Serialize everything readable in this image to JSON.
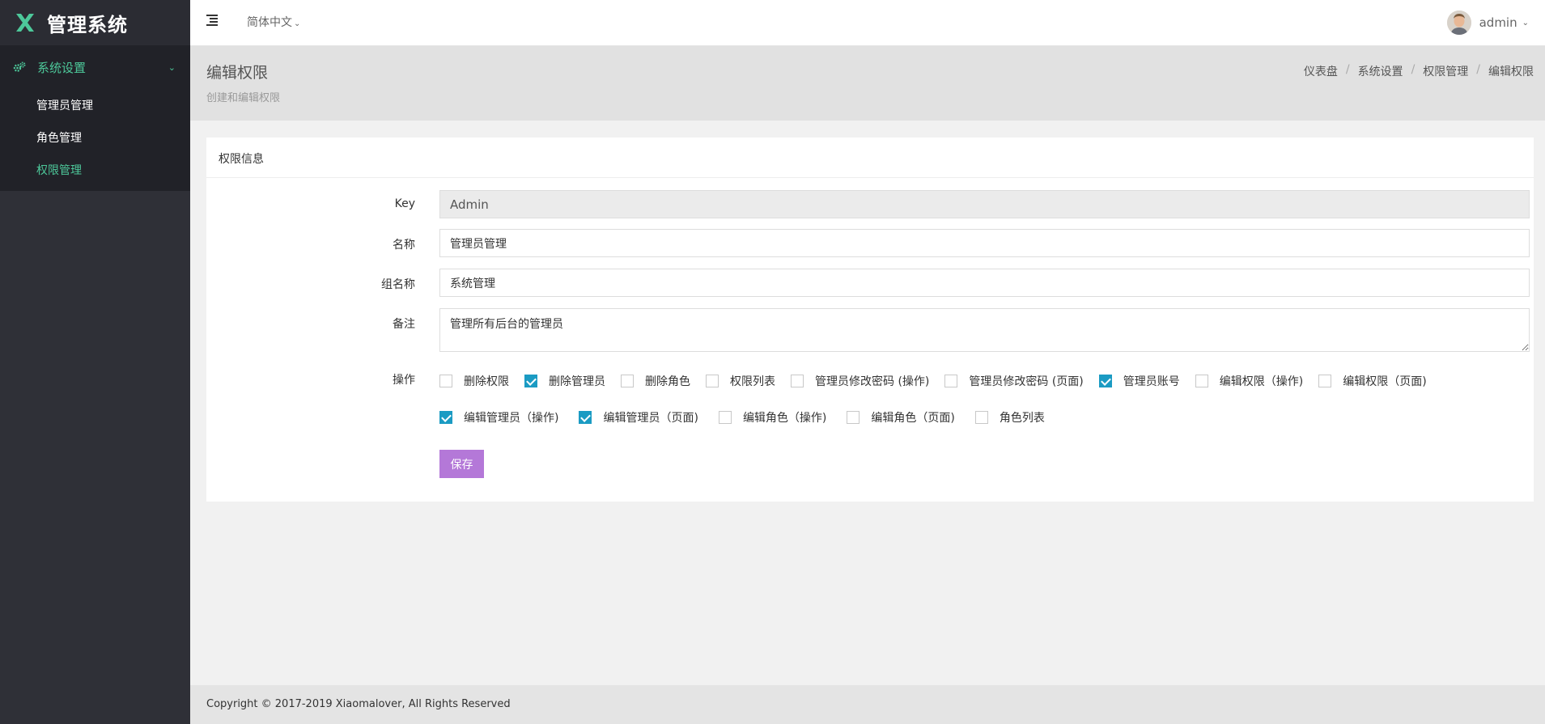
{
  "brand": {
    "title": "管理系统",
    "logo_icon": "x-logo-icon",
    "logo_color": "#4dc89a"
  },
  "sidebar": {
    "group_label": "系统设置",
    "group_icon": "gears-icon",
    "items": [
      {
        "label": "管理员管理",
        "active": false
      },
      {
        "label": "角色管理",
        "active": false
      },
      {
        "label": "权限管理",
        "active": true
      }
    ]
  },
  "header": {
    "language": "简体中文",
    "user_name": "admin"
  },
  "page": {
    "title": "编辑权限",
    "subtitle": "创建和编辑权限",
    "breadcrumbs": [
      "仪表盘",
      "系统设置",
      "权限管理",
      "编辑权限"
    ]
  },
  "card": {
    "title": "权限信息",
    "fields": {
      "key_label": "Key",
      "key_value": "Admin",
      "name_label": "名称",
      "name_value": "管理员管理",
      "group_label": "组名称",
      "group_value": "系统管理",
      "remark_label": "备注",
      "remark_value": "管理所有后台的管理员",
      "ops_label": "操作"
    },
    "operations_row1": [
      {
        "label": "删除权限",
        "checked": false
      },
      {
        "label": "删除管理员",
        "checked": true
      },
      {
        "label": "删除角色",
        "checked": false
      },
      {
        "label": "权限列表",
        "checked": false
      },
      {
        "label": "管理员修改密码 (操作)",
        "checked": false
      },
      {
        "label": "管理员修改密码 (页面)",
        "checked": false
      },
      {
        "label": "管理员账号",
        "checked": true
      },
      {
        "label": "编辑权限（操作)",
        "checked": false
      },
      {
        "label": "编辑权限（页面)",
        "checked": false
      }
    ],
    "operations_row2": [
      {
        "label": "编辑管理员（操作)",
        "checked": true
      },
      {
        "label": "编辑管理员（页面)",
        "checked": true
      },
      {
        "label": "编辑角色（操作)",
        "checked": false
      },
      {
        "label": "编辑角色（页面)",
        "checked": false
      },
      {
        "label": "角色列表",
        "checked": false
      }
    ],
    "save_label": "保存"
  },
  "footer": {
    "text": "Copyright © 2017-2019 Xiaomalover, All Rights Reserved"
  },
  "colors": {
    "accent_green": "#4dc89a",
    "checkbox_blue": "#1b9bc3",
    "save_purple": "#b478d8",
    "sidebar_bg": "#2f3037"
  }
}
